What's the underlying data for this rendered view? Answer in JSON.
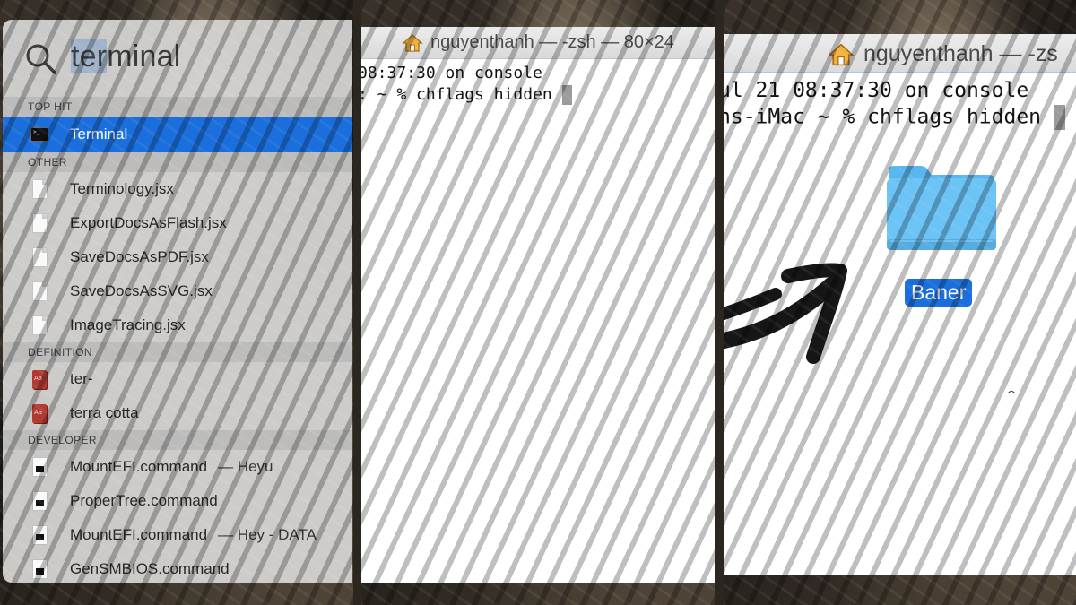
{
  "spotlight": {
    "query": {
      "selected": "ter",
      "rest": "minal"
    },
    "sections": [
      {
        "header": "TOP HIT",
        "items": [
          {
            "label": "Terminal",
            "icon": "terminal-app-icon",
            "active": true
          }
        ]
      },
      {
        "header": "OTHER",
        "items": [
          {
            "label": "Terminology.jsx",
            "icon": "document-icon"
          },
          {
            "label": "ExportDocsAsFlash.jsx",
            "icon": "document-icon"
          },
          {
            "label": "SaveDocsAsPDF.jsx",
            "icon": "document-icon"
          },
          {
            "label": "SaveDocsAsSVG.jsx",
            "icon": "document-icon"
          },
          {
            "label": "ImageTracing.jsx",
            "icon": "document-icon"
          }
        ]
      },
      {
        "header": "DEFINITION",
        "items": [
          {
            "label": "ter-",
            "icon": "dictionary-icon"
          },
          {
            "label": "terra cotta",
            "icon": "dictionary-icon"
          }
        ]
      },
      {
        "header": "DEVELOPER",
        "items": [
          {
            "label": "MountEFI.command",
            "sub": "— Heyu",
            "icon": "command-file-icon"
          },
          {
            "label": "ProperTree.command",
            "icon": "command-file-icon"
          },
          {
            "label": "MountEFI.command",
            "sub": "— Hey - DATA",
            "icon": "command-file-icon"
          },
          {
            "label": "GenSMBIOS.command",
            "icon": "command-file-icon"
          }
        ]
      }
    ]
  },
  "terminal_small": {
    "title": "nguyenthanh — -zsh — 80×24",
    "lines": [
      "08:37:30 on console",
      ": ~ % chflags hidden "
    ]
  },
  "terminal_large": {
    "title": "nguyenthanh — -zs",
    "lines": [
      "ul 21 08:37:30 on console",
      "ns-iMac ~ % chflags hidden "
    ]
  },
  "folder": {
    "label": "Baner",
    "color": "#6cc3f5"
  },
  "colors": {
    "selection": "#1a6fdd",
    "query_highlight": "#9fb3cc"
  }
}
